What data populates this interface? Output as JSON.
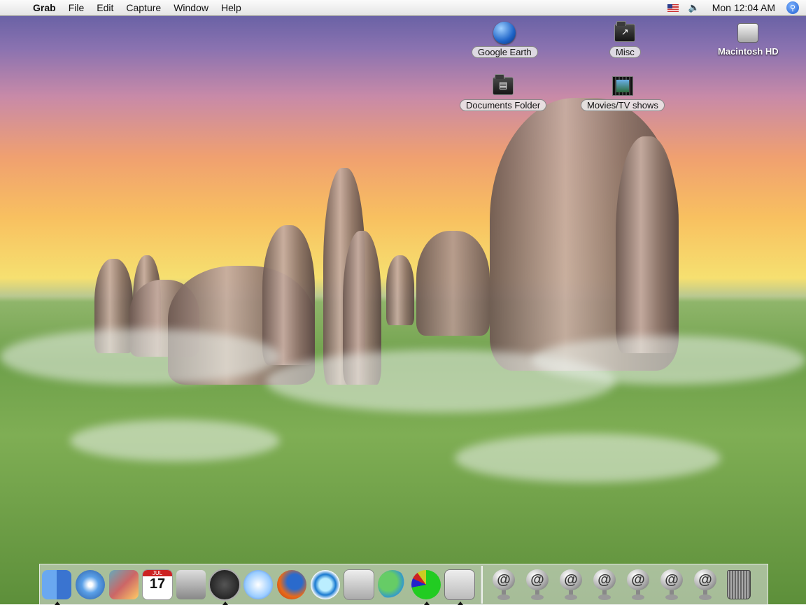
{
  "menubar": {
    "app_name": "Grab",
    "menus": [
      "File",
      "Edit",
      "Capture",
      "Window",
      "Help"
    ],
    "clock": "Mon 12:04 AM",
    "apple_icon": "apple-logo-icon",
    "input_icon": "us-flag-icon",
    "volume_icon": "volume-icon",
    "spotlight_icon": "spotlight-search-icon"
  },
  "desktop": {
    "icons": [
      {
        "label": "Google Earth",
        "icon": "google-earth-globe-icon"
      },
      {
        "label": "Misc",
        "icon": "folder-icon"
      },
      {
        "label": "Macintosh HD",
        "icon": "hard-drive-icon"
      },
      {
        "label": "Documents Folder",
        "icon": "documents-folder-icon"
      },
      {
        "label": "Movies/TV shows",
        "icon": "movie-film-icon"
      }
    ],
    "wallpaper": "fantasy landscape with rock arches over green terrain"
  },
  "dock": {
    "apps": [
      {
        "icon": "finder-icon",
        "running": true
      },
      {
        "icon": "safari-compass-icon",
        "running": false
      },
      {
        "icon": "iphoto-icon",
        "running": false
      },
      {
        "icon": "ical-calendar-icon",
        "running": false,
        "text": "17",
        "month": "JUL"
      },
      {
        "icon": "image-capture-camera-icon",
        "running": false
      },
      {
        "icon": "dashboard-icon",
        "running": true
      },
      {
        "icon": "itunes-icon",
        "running": false
      },
      {
        "icon": "firefox-icon",
        "running": false
      },
      {
        "icon": "quicktime-icon",
        "running": false
      },
      {
        "icon": "system-preferences-icon",
        "running": false
      },
      {
        "icon": "msn-messenger-icon",
        "running": false
      },
      {
        "icon": "activity-monitor-pie-icon",
        "running": true
      },
      {
        "icon": "grab-icon",
        "running": true
      }
    ],
    "docs": [
      "at-sign-icon",
      "at-sign-icon",
      "at-sign-icon",
      "at-sign-icon",
      "at-sign-icon",
      "at-sign-icon",
      "at-sign-icon"
    ],
    "trash_icon": "trash-icon"
  },
  "colors": {
    "menubar_bg": "#ececec",
    "accent": "#2f6fd8"
  }
}
